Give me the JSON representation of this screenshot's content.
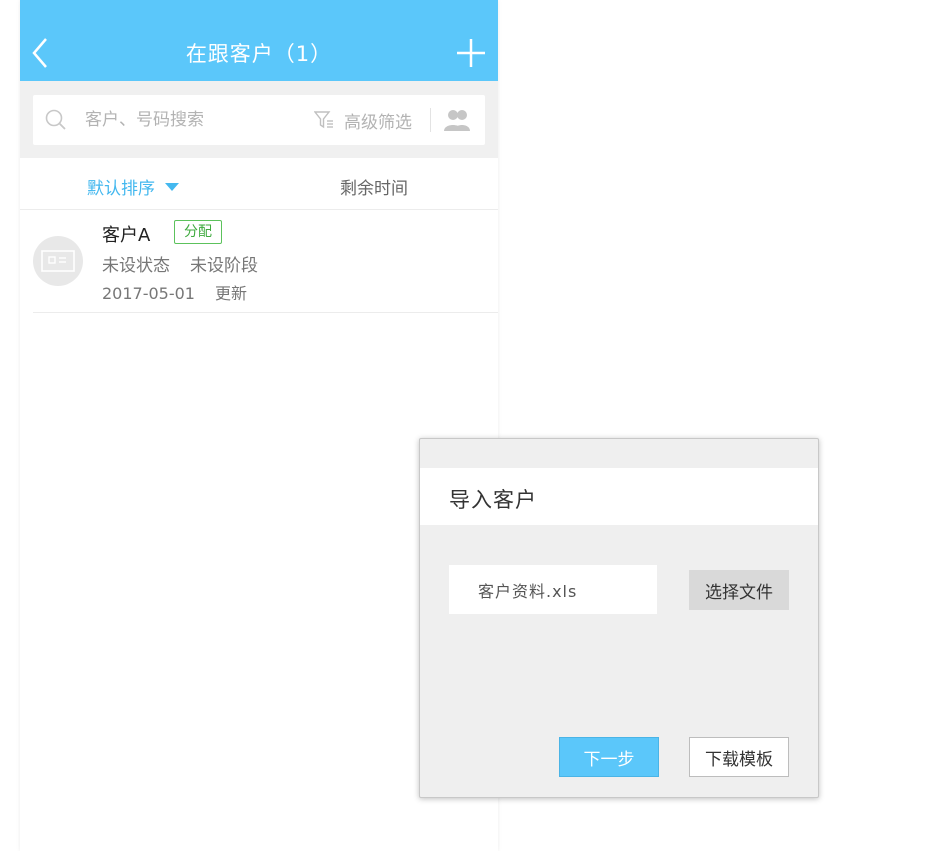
{
  "header": {
    "title": "在跟客户（1）",
    "back_icon": "chevron-left-icon",
    "add_icon": "plus-icon"
  },
  "search": {
    "placeholder": "客户、号码搜索",
    "filter_label": "高级筛选"
  },
  "sort_bar": {
    "default_label": "默认排序",
    "remaining_label": "剩余时间"
  },
  "customers": [
    {
      "name": "客户A",
      "badge": "分配",
      "status": "未设状态",
      "stage": "未设阶段",
      "date": "2017-05-01",
      "update_label": "更新"
    }
  ],
  "dialog": {
    "title": "导入客户",
    "file_value": "客户资料.xls",
    "choose_label": "选择文件",
    "next_label": "下一步",
    "template_label": "下载模板"
  },
  "colors": {
    "accent": "#5bc7fa",
    "sort_active": "#44b8ef",
    "badge_green": "#3faa3f"
  }
}
